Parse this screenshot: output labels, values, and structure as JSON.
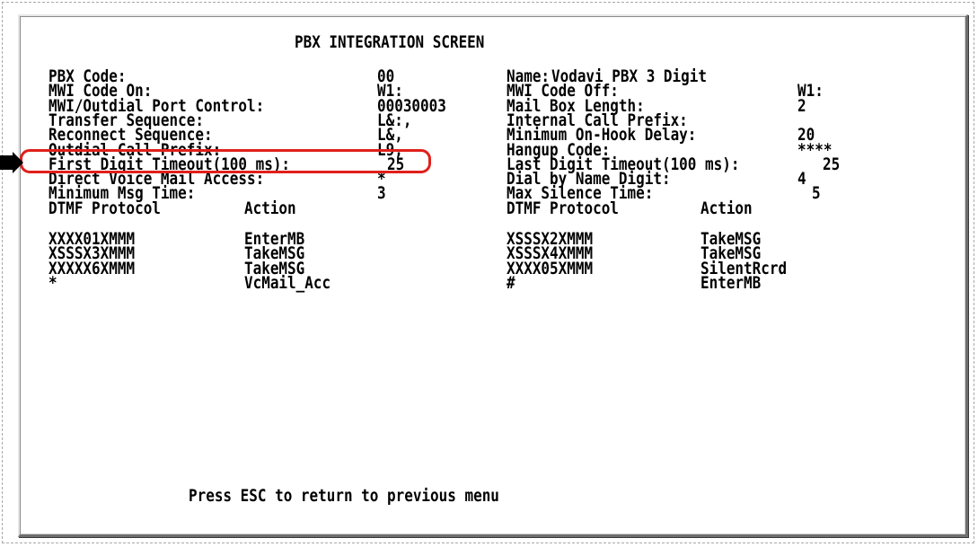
{
  "screen": {
    "title": "PBX INTEGRATION SCREEN",
    "footer": "Press ESC to return to previous menu"
  },
  "left_fields": [
    {
      "label": "PBX Code:",
      "value": "00"
    },
    {
      "label": "MWI Code On:",
      "value": "W1:"
    },
    {
      "label": "MWI/Outdial Port Control:",
      "value": "00030003"
    },
    {
      "label": "Transfer Sequence:",
      "value": "L&:,"
    },
    {
      "label": "Reconnect Sequence:",
      "value": "L&,"
    },
    {
      "label": "Outdial Call Prefix:",
      "value": "L9,"
    },
    {
      "label": "First Digit Timeout(100 ms):",
      "value": "25"
    },
    {
      "label": "Direct Voice Mail Access:",
      "value": "*"
    },
    {
      "label": "Minimum Msg Time:",
      "value": "3"
    }
  ],
  "right_fields": [
    {
      "label": "Name:",
      "value": "Vodavi PBX 3 Digit"
    },
    {
      "label": "MWI Code Off:",
      "value": "W1:"
    },
    {
      "label": "Mail Box Length:",
      "value": "2"
    },
    {
      "label": "Internal Call Prefix:",
      "value": ""
    },
    {
      "label": "Minimum On-Hook Delay:",
      "value": "20"
    },
    {
      "label": "Hangup Code:",
      "value": "****"
    },
    {
      "label": "Last Digit Timeout(100 ms):",
      "value": "25"
    },
    {
      "label": "Dial by Name Digit:",
      "value": "4"
    },
    {
      "label": "Max Silence Time:",
      "value": "5"
    }
  ],
  "dtmf_headers": {
    "protocol": "DTMF Protocol",
    "action": "Action"
  },
  "dtmf_left": [
    {
      "protocol": "XXXX01XMMM",
      "action": "EnterMB"
    },
    {
      "protocol": "XSSSX3XMMM",
      "action": "TakeMSG"
    },
    {
      "protocol": "XXXXX6XMMM",
      "action": "TakeMSG"
    },
    {
      "protocol": "*",
      "action": "VcMail_Acc"
    }
  ],
  "dtmf_right": [
    {
      "protocol": "XSSSX2XMMM",
      "action": "TakeMSG"
    },
    {
      "protocol": "XSSSX4XMMM",
      "action": "TakeMSG"
    },
    {
      "protocol": "XXXX05XMMM",
      "action": "SilentRcrd"
    },
    {
      "protocol": "#",
      "action": "EnterMB"
    }
  ],
  "annotation": {
    "highlight_color": "#e0201c",
    "arrow_icon": "arrow-right-icon",
    "highlighted_field": "Outdial Call Prefix:"
  }
}
